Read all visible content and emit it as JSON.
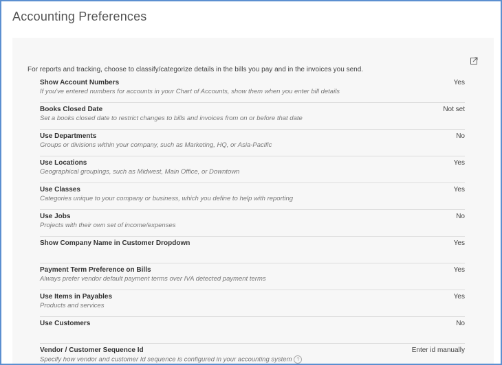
{
  "page": {
    "title": "Accounting Preferences",
    "intro": "For reports and tracking, choose to classify/categorize details in the bills you pay and in the invoices you send."
  },
  "preferences": [
    {
      "label": "Show Account Numbers",
      "description": "If you've entered numbers for accounts in your Chart of Accounts, show them when you enter bill details",
      "value": "Yes"
    },
    {
      "label": "Books Closed Date",
      "description": "Set a books closed date to restrict changes to bills and invoices from on or before that date",
      "value": "Not set"
    },
    {
      "label": "Use Departments",
      "description": "Groups or divisions within your company, such as Marketing, HQ, or Asia-Pacific",
      "value": "No"
    },
    {
      "label": "Use Locations",
      "description": "Geographical groupings, such as Midwest, Main Office, or Downtown",
      "value": "Yes"
    },
    {
      "label": "Use Classes",
      "description": "Categories unique to your company or business, which you define to help with reporting",
      "value": "Yes"
    },
    {
      "label": "Use Jobs",
      "description": "Projects with their own set of income/expenses",
      "value": "No"
    },
    {
      "label": "Show Company Name in Customer Dropdown",
      "description": "",
      "value": "Yes"
    },
    {
      "label": "Payment Term Preference on Bills",
      "description": "Always prefer vendor default payment terms over IVA detected payment terms",
      "value": "Yes"
    },
    {
      "label": "Use Items in Payables",
      "description": "Products and services",
      "value": "Yes"
    },
    {
      "label": "Use Customers",
      "description": "",
      "value": "No"
    },
    {
      "label": "Vendor / Customer Sequence Id",
      "description": "Specify how vendor and customer Id sequence is configured in your accounting system",
      "value": "Enter id manually"
    }
  ],
  "icons": {
    "edit": "edit-icon",
    "help": "question-circle-icon",
    "help_glyph": "?"
  },
  "colors": {
    "frame_border": "#5b8fd0",
    "panel_bg": "#f7f7f7"
  }
}
